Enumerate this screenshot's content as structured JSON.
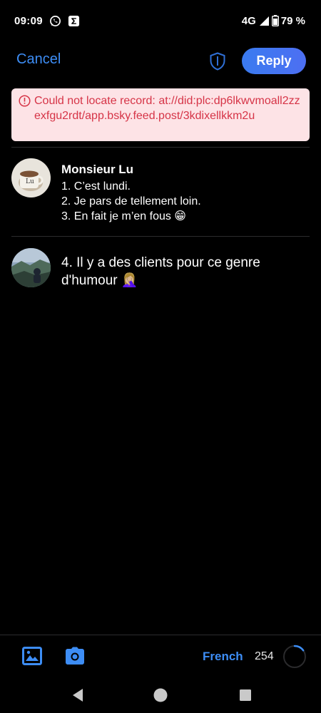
{
  "status_bar": {
    "time": "09:09",
    "network": "4G",
    "battery": "79 %",
    "icons": [
      "whatsapp-icon",
      "sigma-app-icon",
      "signal-icon",
      "battery-icon"
    ]
  },
  "header": {
    "cancel_label": "Cancel",
    "reply_label": "Reply",
    "shield_icon": "shield-icon"
  },
  "error": {
    "message": "Could not locate record: at://did:plc:dp6lkwvmoall2zzexfgu2rdt/app.bsky.feed.post/3kdixellkkm2u",
    "icon": "alert-circle-icon"
  },
  "parent_post": {
    "author": "Monsieur Lu",
    "lines": [
      "1. C’est lundi.",
      "2. Je pars de tellement loin.",
      "3. En fait je m’en fous 😁"
    ]
  },
  "compose": {
    "text": "4. Il y a des clients pour ce genre d'humour 🤦🏼‍♀️"
  },
  "toolbar": {
    "language": "French",
    "remaining_chars": "254",
    "char_progress": 0.15,
    "icons": [
      "image-icon",
      "camera-icon"
    ]
  },
  "colors": {
    "accent": "#3d8df5",
    "error_bg": "#fde3e6",
    "error_text": "#d63447",
    "background": "#000000"
  }
}
